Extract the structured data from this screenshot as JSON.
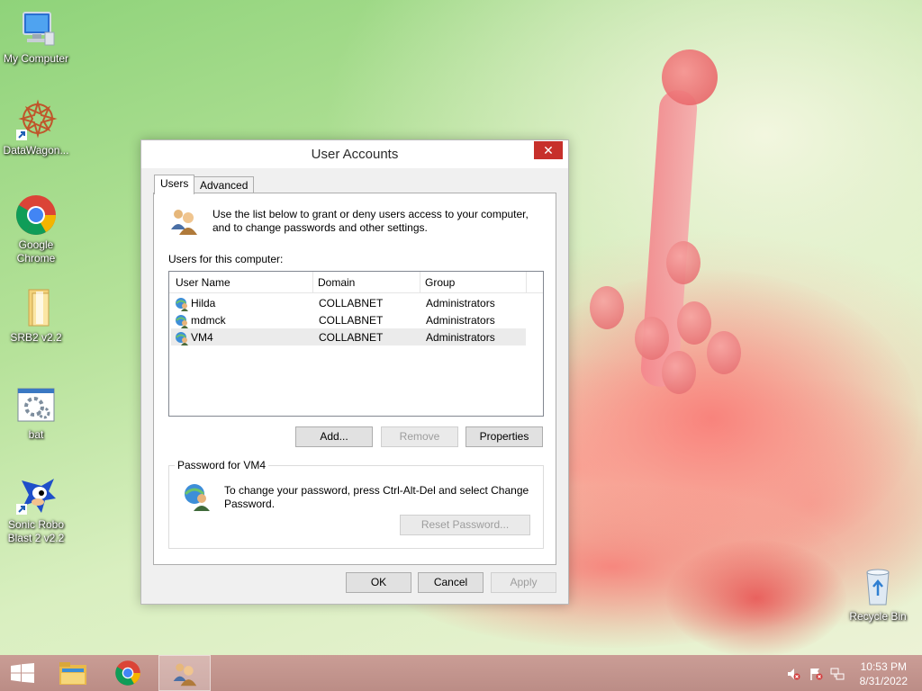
{
  "desktop": {
    "icons": [
      {
        "label": "My Computer"
      },
      {
        "label": "DataWagon..."
      },
      {
        "label": "Google Chrome"
      },
      {
        "label": "SRB2 v2.2"
      },
      {
        "label": "bat"
      },
      {
        "label": "Sonic Robo Blast 2 v2.2"
      },
      {
        "label": "Recycle Bin"
      }
    ]
  },
  "dialog": {
    "title": "User Accounts",
    "close_glyph": "✕",
    "tabs": [
      {
        "label": "Users",
        "active": true
      },
      {
        "label": "Advanced",
        "active": false
      }
    ],
    "intro_text": "Use the list below to grant or deny users access to your computer, and to change passwords and other settings.",
    "users_label": "Users for this computer:",
    "columns": [
      "User Name",
      "Domain",
      "Group"
    ],
    "rows": [
      {
        "name": "Hilda",
        "domain": "COLLABNET",
        "group": "Administrators",
        "selected": false
      },
      {
        "name": "mdmck",
        "domain": "COLLABNET",
        "group": "Administrators",
        "selected": false
      },
      {
        "name": "VM4",
        "domain": "COLLABNET",
        "group": "Administrators",
        "selected": true
      }
    ],
    "buttons": {
      "add": "Add...",
      "remove": "Remove",
      "properties": "Properties",
      "reset_password": "Reset Password...",
      "ok": "OK",
      "cancel": "Cancel",
      "apply": "Apply"
    },
    "password_group": {
      "legend": "Password for VM4",
      "text": "To change your password, press Ctrl-Alt-Del and select Change Password."
    }
  },
  "taskbar": {
    "items": [
      {
        "icon": "windows-start-icon"
      },
      {
        "icon": "file-explorer-icon"
      },
      {
        "icon": "chrome-icon"
      },
      {
        "icon": "user-accounts-icon",
        "active": true
      }
    ],
    "tray": [
      "volume-muted-icon",
      "action-center-flag-icon",
      "network-icon"
    ],
    "clock": {
      "time": "10:53 PM",
      "date": "8/31/2022"
    }
  },
  "colors": {
    "close_button": "#c7302b",
    "selection": "#ebebeb",
    "taskbar": "#bb8985"
  }
}
